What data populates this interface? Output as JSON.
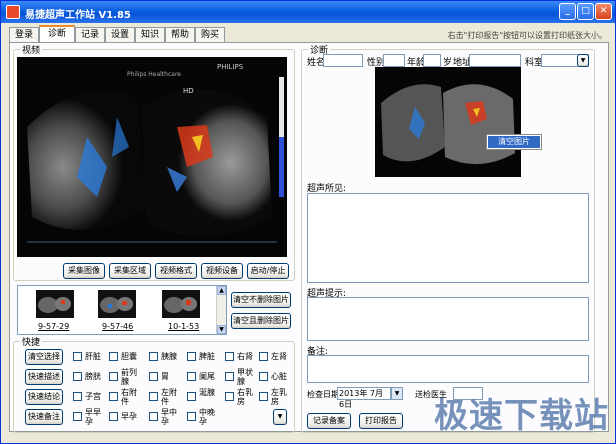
{
  "window": {
    "title": "易捷超声工作站 V1.85"
  },
  "tabs": [
    {
      "label": "登录"
    },
    {
      "label": "诊断"
    },
    {
      "label": "记录"
    },
    {
      "label": "设置"
    },
    {
      "label": "知识"
    },
    {
      "label": "帮助"
    },
    {
      "label": "购买"
    }
  ],
  "hint": "右击\"打印报告\"按钮可以设置打印纸张大小。",
  "video": {
    "label": "视频",
    "overlay_brand": "PHILIPS",
    "overlay_hospital": "Philips Healthcare",
    "overlay_mode": "HD",
    "buttons": [
      "采集图像",
      "采集区域",
      "视频格式",
      "视频设备",
      "启动/停止"
    ]
  },
  "thumbnails": [
    {
      "label": "9-57-29"
    },
    {
      "label": "9-57-46"
    },
    {
      "label": "10-1-53"
    }
  ],
  "thumb_buttons": {
    "clear_keep": "清空不删除图片",
    "clear_delete": "清空且删除图片"
  },
  "quick": {
    "label": "快捷",
    "rows": [
      {
        "button": "清空选择",
        "items": [
          "肝脏",
          "胆囊",
          "胰腺",
          "脾脏",
          "右肾",
          "左肾"
        ]
      },
      {
        "button": "快速描述",
        "items": [
          "膀胱",
          "前列腺",
          "胃",
          "阑尾",
          "甲状腺",
          "心脏"
        ]
      },
      {
        "button": "快速结论",
        "items": [
          "子宫",
          "右附件",
          "左附件",
          "涎腺",
          "右乳房",
          "左乳房"
        ]
      },
      {
        "button": "快速备注",
        "items": [
          "早早孕",
          "早孕",
          "早中孕",
          "中晚孕"
        ]
      }
    ]
  },
  "diagnosis": {
    "label": "诊断",
    "fields": {
      "name": "姓名",
      "gender": "性别",
      "age": "年龄",
      "age_unit": "岁",
      "address": "地址",
      "department": "科室"
    },
    "context_menu": "清空图片",
    "findings_label": "超声所见:",
    "impression_label": "超声提示:",
    "notes_label": "备注:",
    "exam_date_label": "检查日期",
    "exam_date_value": "2013年 7月 6日",
    "doctor_label": "送检医生",
    "buttons": {
      "save": "记录备案",
      "print": "打印报告"
    }
  },
  "watermark": "极速下载站",
  "colors": {
    "titlebar": "#0a5fe0",
    "tab_active_accent": "#e68b2c",
    "context_menu": "#316ac5",
    "watermark": "#4a6fa5"
  },
  "icons": {
    "minimize": "minimize-icon",
    "maximize": "maximize-icon",
    "close": "close-icon"
  }
}
